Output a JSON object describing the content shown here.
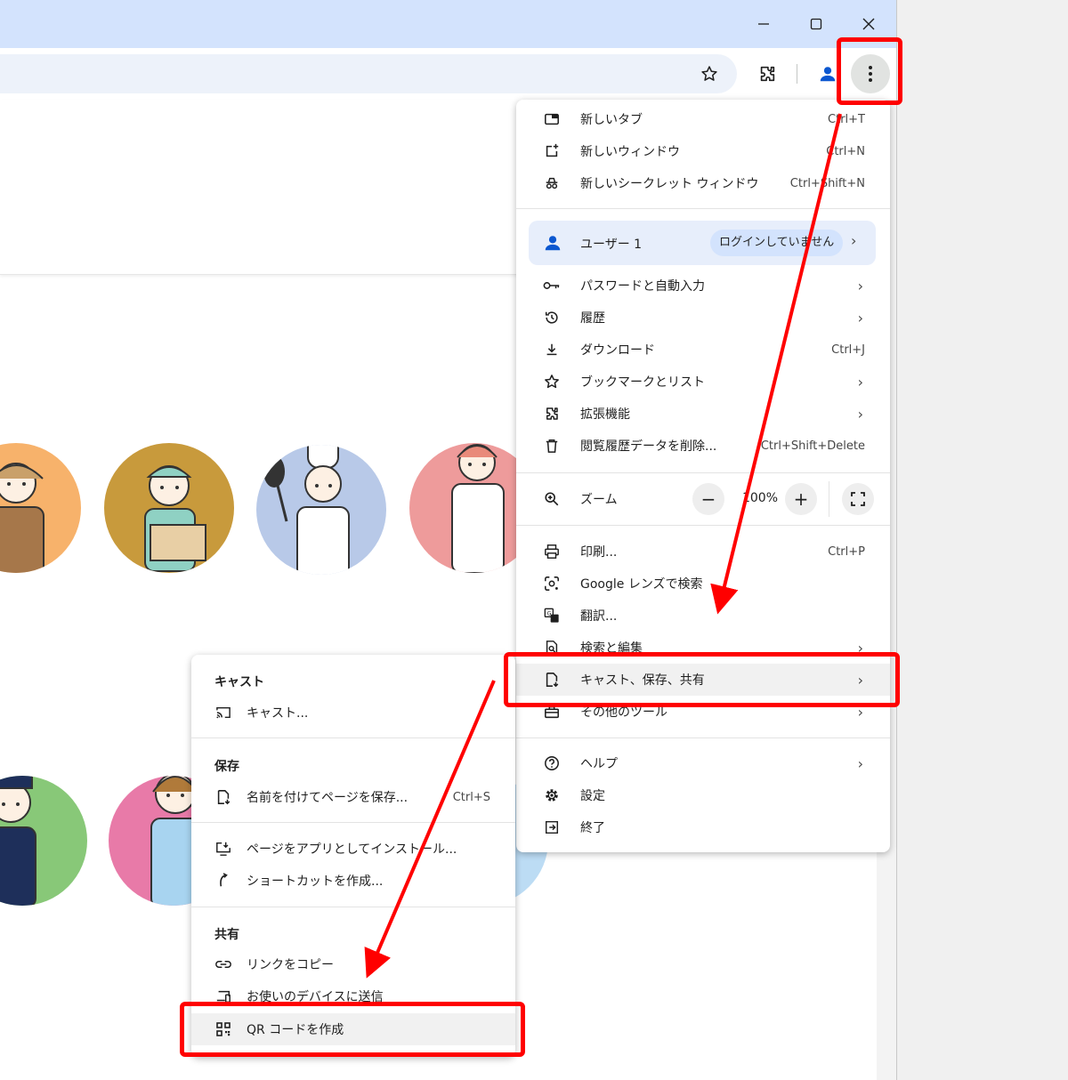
{
  "menu": {
    "items": [
      {
        "label": "新しいタブ",
        "shortcut": "Ctrl+T",
        "icon": "new-tab-icon"
      },
      {
        "label": "新しいウィンドウ",
        "shortcut": "Ctrl+N",
        "icon": "new-window-icon"
      },
      {
        "label": "新しいシークレット ウィンドウ",
        "shortcut": "Ctrl+Shift+N",
        "icon": "incognito-icon"
      }
    ],
    "profile": {
      "label": "ユーザー 1",
      "status": "ログインしていません",
      "icon": "person-icon"
    },
    "items2": [
      {
        "label": "パスワードと自動入力",
        "shortcut": "",
        "icon": "key-icon"
      },
      {
        "label": "履歴",
        "shortcut": "",
        "icon": "history-icon"
      },
      {
        "label": "ダウンロード",
        "shortcut": "Ctrl+J",
        "icon": "download-icon"
      },
      {
        "label": "ブックマークとリスト",
        "shortcut": "",
        "icon": "star-icon"
      },
      {
        "label": "拡張機能",
        "shortcut": "",
        "icon": "extension-icon"
      },
      {
        "label": "閲覧履歴データを削除...",
        "shortcut": "Ctrl+Shift+Delete",
        "icon": "trash-icon"
      }
    ],
    "zoom": {
      "label": "ズーム",
      "value": "100%",
      "minus": "−",
      "plus": "+"
    },
    "items3": [
      {
        "label": "印刷...",
        "shortcut": "Ctrl+P",
        "icon": "print-icon"
      },
      {
        "label": "Google レンズで検索",
        "shortcut": "",
        "icon": "lens-icon"
      },
      {
        "label": "翻訳...",
        "shortcut": "",
        "icon": "translate-icon"
      },
      {
        "label": "検索と編集",
        "shortcut": "",
        "icon": "search-edit-icon"
      },
      {
        "label": "キャスト、保存、共有",
        "shortcut": "",
        "icon": "cast-save-share-icon"
      },
      {
        "label": "その他のツール",
        "shortcut": "",
        "icon": "toolbox-icon"
      }
    ],
    "items4": [
      {
        "label": "ヘルプ",
        "icon": "help-icon"
      },
      {
        "label": "設定",
        "icon": "gear-icon"
      },
      {
        "label": "終了",
        "icon": "exit-icon"
      }
    ],
    "arrow": "›"
  },
  "submenu": {
    "cast_header": "キャスト",
    "cast": {
      "label": "キャスト...",
      "icon": "cast-icon"
    },
    "save_header": "保存",
    "save_as": {
      "label": "名前を付けてページを保存...",
      "shortcut": "Ctrl+S",
      "icon": "save-page-icon"
    },
    "install": {
      "label": "ページをアプリとしてインストール...",
      "icon": "install-icon"
    },
    "shortcut": {
      "label": "ショートカットを作成...",
      "icon": "shortcut-icon"
    },
    "share_header": "共有",
    "copy_link": {
      "label": "リンクをコピー",
      "icon": "link-icon"
    },
    "send": {
      "label": "お使いのデバイスに送信",
      "icon": "devices-icon"
    },
    "qr": {
      "label": "QR コードを作成",
      "icon": "qr-code-icon"
    }
  },
  "colors": {
    "titlebar": "#d3e3fd",
    "omnibox": "#edf2fa",
    "accent": "#0b57d0",
    "annotation": "#ff0000",
    "avatar_orange": "#f7b26b",
    "avatar_mustard": "#c89a3c",
    "avatar_blue": "#b8c9e8",
    "avatar_pink": "#ee9b9b",
    "avatar_green": "#88c878",
    "avatar_magenta": "#e87aa8"
  }
}
